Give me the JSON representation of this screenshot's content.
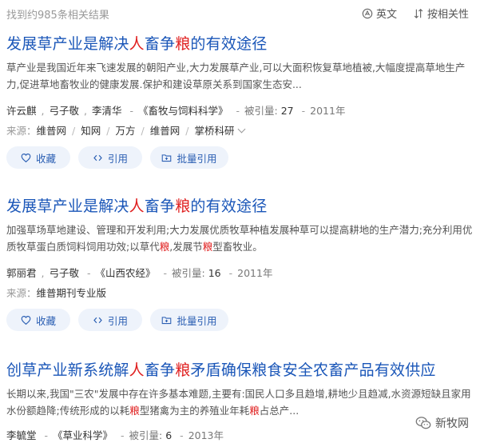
{
  "header": {
    "result_count": "找到约985条相关结果",
    "lang_toggle": "英文",
    "sort_label": "按相关性"
  },
  "labels": {
    "source_prefix": "来源：",
    "cited_prefix": "被引量:",
    "sep": "-",
    "slash": "/"
  },
  "actions": {
    "favorite": "收藏",
    "cite": "引用",
    "batch_cite": "批量引用"
  },
  "results": [
    {
      "title_parts": [
        "发展草产业是解决",
        "人",
        "畜争",
        "粮",
        "的有效途径"
      ],
      "abstract_parts": [
        "草产业是我国近年来飞速发展的朝阳产业,大力发展草产业,可以大面积恢复草地植被,大幅度提高草地生产力,促进草地畜牧业的健康发展.保护和建设草原关系到国家生态安..."
      ],
      "authors": [
        "许云麒",
        "弓子敬",
        "李清华"
      ],
      "journal": "《畜牧与饲料科学》",
      "cited": "27",
      "year": "2011年",
      "sources": [
        "维普网",
        "知网",
        "万方",
        "维普网",
        "掌桥科研"
      ]
    },
    {
      "title_parts": [
        "发展草产业是解决",
        "人",
        "畜争",
        "粮",
        "的有效途径"
      ],
      "abstract_parts": [
        "加强草场草地建设、管理和开发利用;大力发展优质牧草种植发展种草可以提高耕地的生产潜力;充分利用优质牧草蛋白质饲料饲用功效;以草代",
        "粮",
        ",发展节",
        "粮",
        "型畜牧业。"
      ],
      "authors": [
        "郭丽君",
        "弓子敬"
      ],
      "journal": "《山西农经》",
      "cited": "16",
      "year": "2011年",
      "sources": [
        "维普期刊专业版"
      ]
    },
    {
      "title_parts": [
        "创草产业新系统解",
        "人",
        "畜争",
        "粮",
        "矛盾确保粮食安全农畜产品有效供应"
      ],
      "abstract_parts": [
        "长期以来,我国\"三农\"发展中存在许多基本难题,主要有:国民人口多且趋增,耕地少且趋减,水资源短缺且家用水份额趋降;传统形成的以耗",
        "粮",
        "型猪禽为主的养殖业年耗",
        "粮",
        "占总产..."
      ],
      "authors": [
        "李毓堂"
      ],
      "journal": "《草业科学》",
      "cited": "6",
      "year": "2013年"
    }
  ],
  "watermark": {
    "text": "新牧网"
  },
  "colors": {
    "link": "#1a56b8",
    "highlight": "#e02020",
    "button_bg": "#eef3fb",
    "button_text": "#2b5fb3"
  }
}
